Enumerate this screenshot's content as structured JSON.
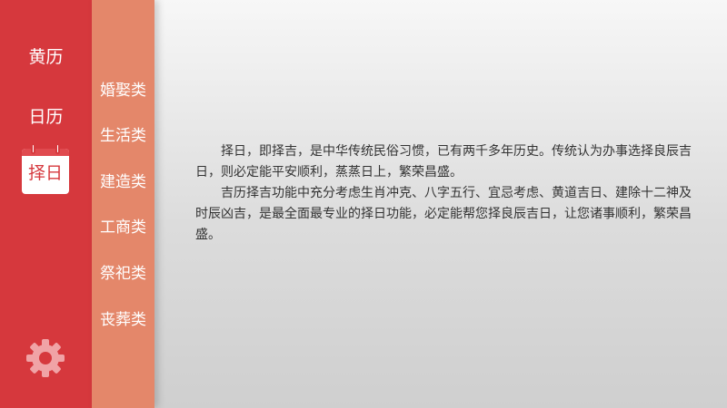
{
  "nav": {
    "items": [
      {
        "label": "黄历"
      },
      {
        "label": "日历"
      },
      {
        "label": "择日"
      }
    ],
    "active_index": 2,
    "settings_icon": "gear-icon"
  },
  "subnav": {
    "items": [
      {
        "label": "婚娶类"
      },
      {
        "label": "生活类"
      },
      {
        "label": "建造类"
      },
      {
        "label": "工商类"
      },
      {
        "label": "祭祀类"
      },
      {
        "label": "丧葬类"
      }
    ]
  },
  "content": {
    "paragraphs": [
      "择日，即择吉，是中华传统民俗习惯，已有两千多年历史。传统认为办事选择良辰吉日，则必定能平安顺利，蒸蒸日上，繁荣昌盛。",
      "吉历择吉功能中充分考虑生肖冲克、八字五行、宜忌考虑、黄道吉日、建除十二神及时辰凶吉，是最全面最专业的择日功能，必定能帮您择良辰吉日，让您诸事顺利，繁荣昌盛。"
    ]
  },
  "colors": {
    "nav_bg": "#d6383d",
    "subnav_bg": "#e4876a",
    "text": "#333333",
    "gear": "#f0a3a6"
  }
}
